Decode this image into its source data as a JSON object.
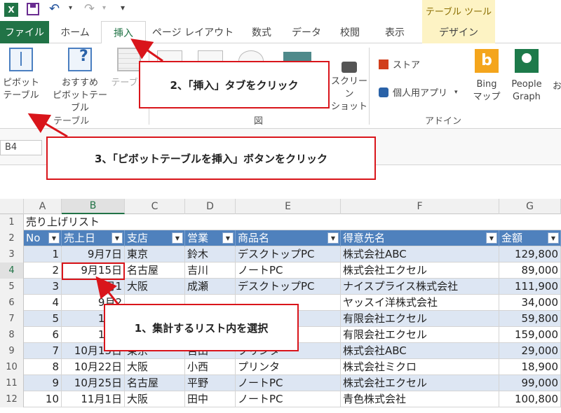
{
  "qat": {
    "excel_letter": "X",
    "customize": "▾"
  },
  "context_tools": "テーブル ツール",
  "tabs": {
    "file": "ファイル",
    "home": "ホーム",
    "insert": "挿入",
    "page_layout": "ページ レイアウト",
    "formulas": "数式",
    "data": "データ",
    "review": "校閲",
    "view": "表示",
    "design": "デザイン"
  },
  "ribbon": {
    "pivot_line1": "ピボット",
    "pivot_line2": "テーブル",
    "recpivot_line1": "おすすめ",
    "recpivot_line2": "ピボットテーブル",
    "table": "テーブル",
    "group_table": "テーブル",
    "group_figure": "図",
    "screenshot_line1": "スクリーン",
    "screenshot_line2": "ショット",
    "store": "ストア",
    "my_apps": "個人用アプリ",
    "bing_line1": "Bing",
    "bing_line2": "マップ",
    "people_line1": "People",
    "people_line2": "Graph",
    "group_addin": "アドイン",
    "more": "お"
  },
  "namebox": "B4",
  "columns": [
    "A",
    "B",
    "C",
    "D",
    "E",
    "F",
    "G"
  ],
  "row1": {
    "num": "1",
    "title": "売り上げリスト"
  },
  "headers": [
    "No",
    "売上日",
    "支店",
    "営業",
    "商品名",
    "得意先名",
    "金額"
  ],
  "rows": [
    {
      "num": "3",
      "no": "1",
      "date": "9月7日",
      "branch": "東京",
      "rep": "鈴木",
      "product": "デスクトップPC",
      "client": "株式会社ABC",
      "amount": "129,800"
    },
    {
      "num": "4",
      "no": "2",
      "date": "9月15日",
      "branch": "名古屋",
      "rep": "吉川",
      "product": "ノートPC",
      "client": "株式会社エクセル",
      "amount": "89,000"
    },
    {
      "num": "5",
      "no": "3",
      "date": "9月1",
      "branch": "大阪",
      "rep": "成瀬",
      "product": "デスクトップPC",
      "client": "ナイスプライス株式会社",
      "amount": "111,900"
    },
    {
      "num": "6",
      "no": "4",
      "date": "9月2",
      "branch": "",
      "rep": "",
      "product": "",
      "client": "ヤッスイ洋株式会社",
      "amount": "34,000"
    },
    {
      "num": "7",
      "no": "5",
      "date": "10月",
      "branch": "",
      "rep": "",
      "product": "",
      "client": "有限会社エクセル",
      "amount": "59,800"
    },
    {
      "num": "8",
      "no": "6",
      "date": "10月",
      "branch": "",
      "rep": "",
      "product": "PC",
      "client": "有限会社エクセル",
      "amount": "159,000"
    },
    {
      "num": "9",
      "no": "7",
      "date": "10月15日",
      "branch": "東京",
      "rep": "吉田",
      "product": "プリンタ",
      "client": "株式会社ABC",
      "amount": "29,000"
    },
    {
      "num": "10",
      "no": "8",
      "date": "10月22日",
      "branch": "大阪",
      "rep": "小西",
      "product": "プリンタ",
      "client": "株式会社ミクロ",
      "amount": "18,900"
    },
    {
      "num": "11",
      "no": "9",
      "date": "10月25日",
      "branch": "名古屋",
      "rep": "平野",
      "product": "ノートPC",
      "client": "株式会社エクセル",
      "amount": "99,000"
    },
    {
      "num": "12",
      "no": "10",
      "date": "11月1日",
      "branch": "大阪",
      "rep": "田中",
      "product": "ノートPC",
      "client": "青色株式会社",
      "amount": "100,800"
    }
  ],
  "callouts": {
    "step1": "1、集計するリスト内を選択",
    "step2": "2、「挿入」タブをクリック",
    "step3": "3、「ピボットテーブルを挿入」ボタンをクリック"
  },
  "colors": {
    "accent": "#217346",
    "callout_border": "#d9151b",
    "table_header": "#4f81bd",
    "band": "#dde6f3"
  }
}
